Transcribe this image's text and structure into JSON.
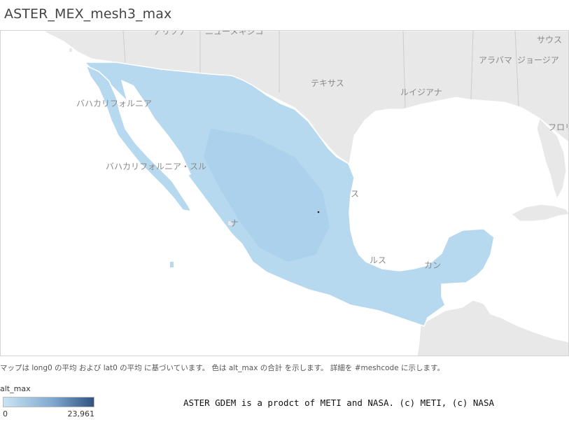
{
  "title": "ASTER_MEX_mesh3_max",
  "map": {
    "labels": {
      "arizona": "アリゾナ",
      "new_mexico": "ニューメキシコ",
      "texas": "テキサス",
      "louisiana": "ルイジアナ",
      "alabama": "アラバマ",
      "georgia": "ジョージア",
      "south": "サウス",
      "florida": "フロリ",
      "baja_norte": "バハカリフォルニア",
      "baja_sur": "バハカリフォルニア・スル",
      "tamaulipas": "ス",
      "veracruz": "ルス",
      "campeche": "カン",
      "nayarit": "ナ"
    },
    "colors": {
      "ocean": "#ffffff",
      "land": "#e8e8e8",
      "border": "#ffffff",
      "mexico_fill": "#b7d9ef",
      "mexico_dark": "#9fc7e6"
    }
  },
  "note": "マップは long0 の平均 および lat0 の平均 に基づいています。 色は alt_max の合計 を示します。 詳細を #meshcode に示します。",
  "legend": {
    "title": "alt_max",
    "min": "0",
    "max": "23,961",
    "gradient_start": "#c9e3f4",
    "gradient_end": "#2f5480"
  },
  "credit": "ASTER GDEM is a prodct of METI and NASA. (c) METI, (c) NASA"
}
